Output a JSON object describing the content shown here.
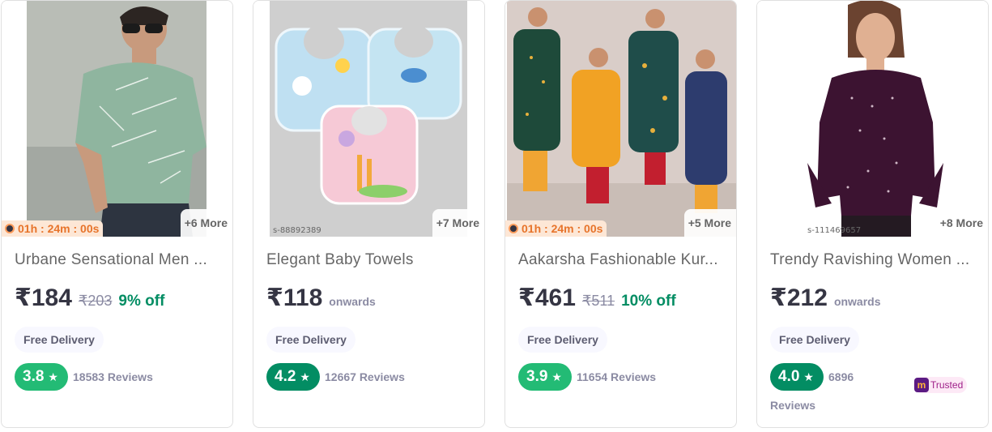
{
  "products": [
    {
      "title": "Urbane Sensational Men ...",
      "price": "₹184",
      "mrp": "₹203",
      "discount": "9% off",
      "more": "+6 More",
      "timer": "01h : 24m : 00s",
      "delivery": "Free Delivery",
      "rating": "3.8",
      "rating_color": "#23bb75",
      "reviews": "18583 Reviews"
    },
    {
      "title": "Elegant Baby Towels",
      "price": "₹118",
      "onwards": "onwards",
      "more": "+7 More",
      "sku": "s-88892389",
      "delivery": "Free Delivery",
      "rating": "4.2",
      "rating_color": "#038d63",
      "reviews": "12667 Reviews"
    },
    {
      "title": "Aakarsha Fashionable Kur...",
      "price": "₹461",
      "mrp": "₹511",
      "discount": "10% off",
      "more": "+5 More",
      "timer": "01h : 24m : 00s",
      "delivery": "Free Delivery",
      "rating": "3.9",
      "rating_color": "#23bb75",
      "reviews": "11654 Reviews"
    },
    {
      "title": "Trendy Ravishing Women ...",
      "price": "₹212",
      "onwards": "onwards",
      "more": "+8 More",
      "sku": "s-111469657",
      "delivery": "Free Delivery",
      "rating": "4.0",
      "rating_color": "#038d63",
      "reviews_count": "6896",
      "reviews_label": "Reviews",
      "badge": "Trusted",
      "badge_logo": "m"
    }
  ]
}
